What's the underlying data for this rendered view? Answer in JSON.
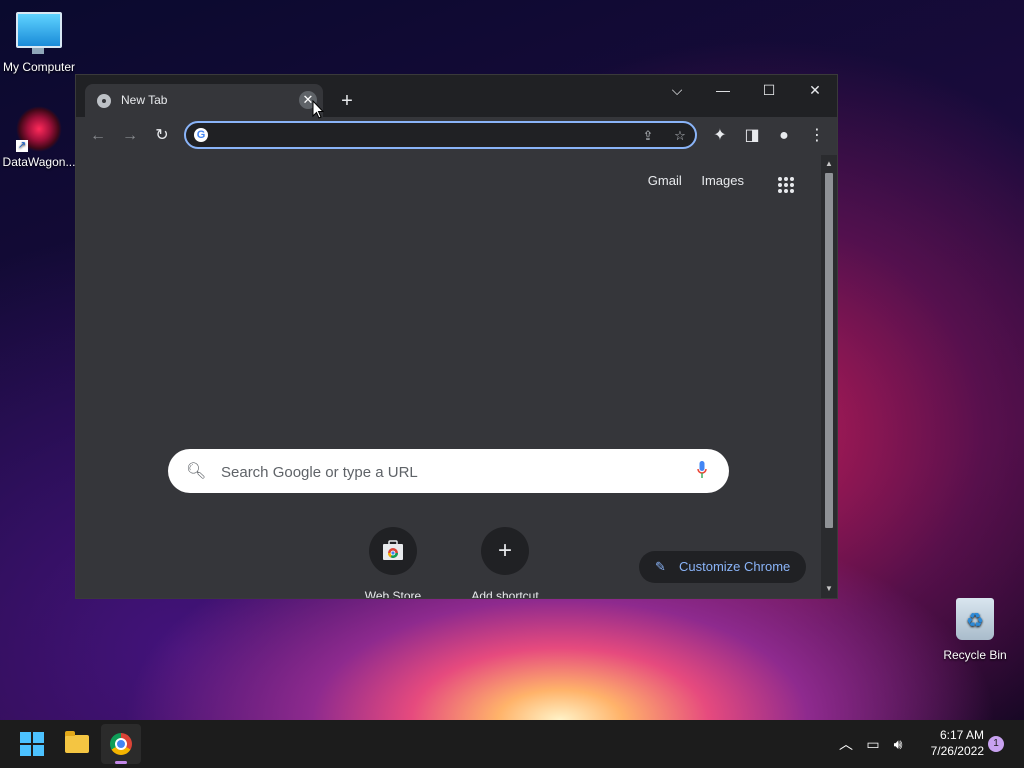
{
  "desktop": {
    "icons": [
      {
        "label": "My Computer"
      },
      {
        "label": "DataWagon..."
      },
      {
        "label": "Recycle Bin"
      }
    ]
  },
  "browser": {
    "tab": {
      "title": "New Tab",
      "close": "✕"
    },
    "new_tab_label": "+",
    "window_controls": {
      "dropdown": "⌵",
      "minimize": "—",
      "maximize": "☐",
      "close": "✕"
    },
    "toolbar": {
      "back": "←",
      "forward": "→",
      "reload": "↻",
      "address_value": "",
      "share": "⇪",
      "star": "☆",
      "extensions": "✦",
      "sidepanel": "◨",
      "profile": "●",
      "menu": "⋮"
    },
    "ntp": {
      "links": {
        "gmail": "Gmail",
        "images": "Images"
      },
      "search_placeholder": "Search Google or type a URL",
      "shortcuts": [
        {
          "label": "Web Store",
          "icon": "webstore-icon"
        },
        {
          "label": "Add shortcut",
          "icon": "plus-icon"
        }
      ],
      "customize_label": "Customize Chrome"
    }
  },
  "taskbar": {
    "clock_time": "6:17 AM",
    "clock_date": "7/26/2022",
    "notification_count": "1"
  },
  "colors": {
    "accent": "#8ab4f8",
    "tab_bg": "#35363a",
    "frame": "#202124"
  }
}
